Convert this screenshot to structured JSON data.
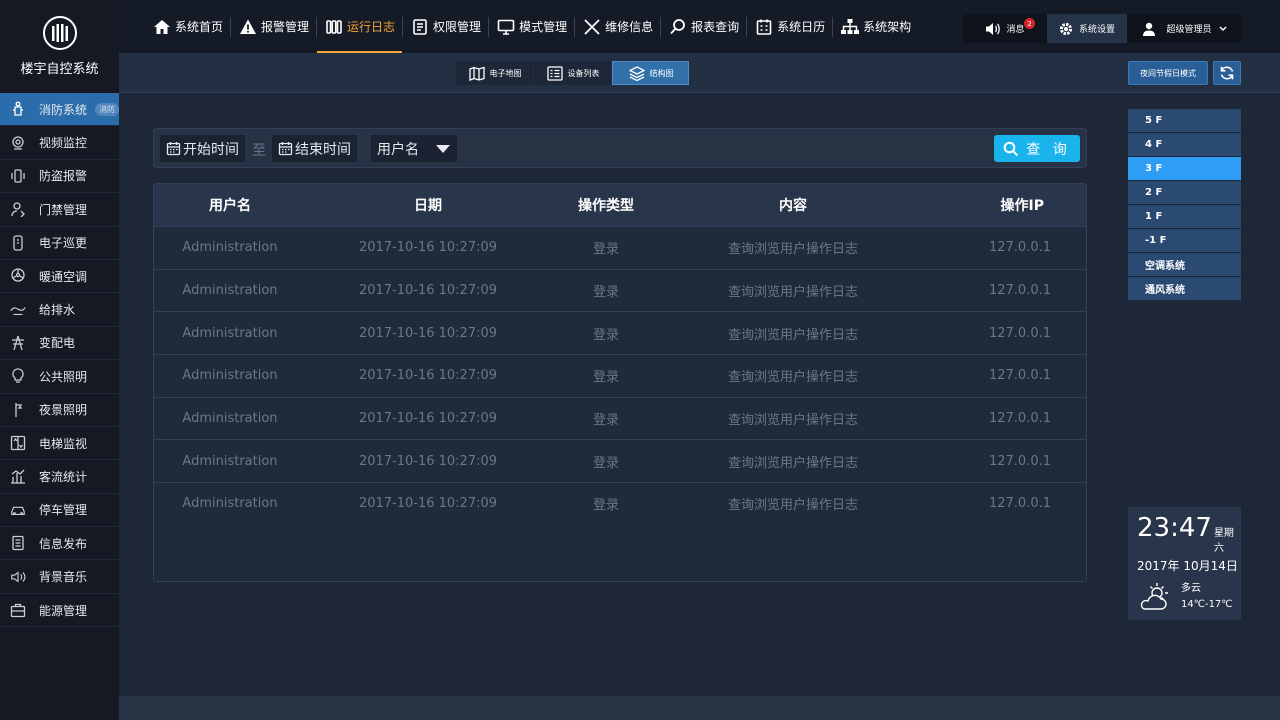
{
  "app": {
    "title": "楼宇自控系统"
  },
  "sidebar": {
    "items": [
      {
        "label": "消防系统",
        "badge": "消防",
        "icon": "fire-hydrant-icon"
      },
      {
        "label": "视频监控",
        "icon": "camera-icon"
      },
      {
        "label": "防盗报警",
        "icon": "alarm-icon"
      },
      {
        "label": "门禁管理",
        "icon": "access-icon"
      },
      {
        "label": "电子巡更",
        "icon": "patrol-icon"
      },
      {
        "label": "暖通空调",
        "icon": "fan-icon"
      },
      {
        "label": "给排水",
        "icon": "water-icon"
      },
      {
        "label": "变配电",
        "icon": "power-tower-icon"
      },
      {
        "label": "公共照明",
        "icon": "bulb-icon"
      },
      {
        "label": "夜景照明",
        "icon": "night-light-icon"
      },
      {
        "label": "电梯监视",
        "icon": "elevator-icon"
      },
      {
        "label": "客流统计",
        "icon": "stats-icon"
      },
      {
        "label": "停车管理",
        "icon": "car-icon"
      },
      {
        "label": "信息发布",
        "icon": "document-icon"
      },
      {
        "label": "背景音乐",
        "icon": "speaker-icon"
      },
      {
        "label": "能源管理",
        "icon": "briefcase-icon"
      }
    ]
  },
  "topnav": {
    "items": [
      {
        "label": "系统首页",
        "icon": "home-icon"
      },
      {
        "label": "报警管理",
        "icon": "warning-icon"
      },
      {
        "label": "运行日志",
        "icon": "log-icon"
      },
      {
        "label": "权限管理",
        "icon": "permission-icon"
      },
      {
        "label": "模式管理",
        "icon": "monitor-icon"
      },
      {
        "label": "维修信息",
        "icon": "tools-icon"
      },
      {
        "label": "报表查询",
        "icon": "search-icon"
      },
      {
        "label": "系统日历",
        "icon": "calendar-icon"
      },
      {
        "label": "系统架构",
        "icon": "architecture-icon"
      }
    ],
    "message_label": "消息",
    "message_count": "2",
    "settings_label": "系统设置",
    "user_label": "超级管理员"
  },
  "subnav": {
    "tabs": [
      {
        "label": "电子地图"
      },
      {
        "label": "设备列表"
      },
      {
        "label": "结构图"
      }
    ],
    "night_mode_label": "夜间节假日模式"
  },
  "filter": {
    "start_label": "开始时间",
    "to_label": "至",
    "end_label": "结束时间",
    "user_select": "用户名",
    "query_label": "查 询"
  },
  "table": {
    "headers": [
      "用户名",
      "日期",
      "操作类型",
      "内容",
      "操作IP"
    ],
    "rows": [
      [
        "Administration",
        "2017-10-16 10:27:09",
        "登录",
        "查询浏览用户操作日志",
        "127.0.0.1"
      ],
      [
        "Administration",
        "2017-10-16 10:27:09",
        "登录",
        "查询浏览用户操作日志",
        "127.0.0.1"
      ],
      [
        "Administration",
        "2017-10-16 10:27:09",
        "登录",
        "查询浏览用户操作日志",
        "127.0.0.1"
      ],
      [
        "Administration",
        "2017-10-16 10:27:09",
        "登录",
        "查询浏览用户操作日志",
        "127.0.0.1"
      ],
      [
        "Administration",
        "2017-10-16 10:27:09",
        "登录",
        "查询浏览用户操作日志",
        "127.0.0.1"
      ],
      [
        "Administration",
        "2017-10-16 10:27:09",
        "登录",
        "查询浏览用户操作日志",
        "127.0.0.1"
      ],
      [
        "Administration",
        "2017-10-16 10:27:09",
        "登录",
        "查询浏览用户操作日志",
        "127.0.0.1"
      ]
    ]
  },
  "floors": {
    "items": [
      "5 F",
      "4 F",
      "3 F",
      "2 F",
      "1 F",
      "-1 F",
      "空调系统",
      "通风系统"
    ],
    "selected": "3 F"
  },
  "weather": {
    "time": "23:47",
    "weekday": "星期六",
    "date": "2017年 10月14日",
    "condition": "多云",
    "temp": "14℃-17℃"
  },
  "colors": {
    "accent": "#f7a23a",
    "active_blue": "#2b6dab",
    "query_button": "#19b4ec",
    "floor_active": "#2f9df3",
    "badge_red": "#d6242d"
  }
}
